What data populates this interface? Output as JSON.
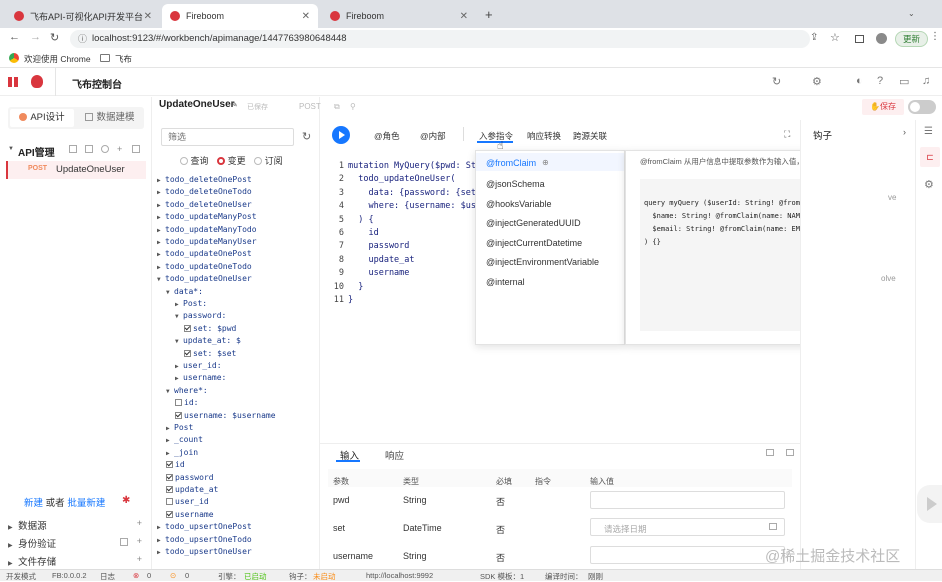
{
  "browser": {
    "tabs": [
      {
        "title": "飞布API-可视化API开发平台",
        "active": false
      },
      {
        "title": "Fireboom",
        "active": true
      },
      {
        "title": "Fireboom",
        "active": false
      }
    ],
    "new_tab": "+",
    "url": "localhost:9123/#/workbench/apimanage/1447763980648448",
    "update_label": "更新",
    "bookmarks": [
      "欢迎使用 Chrome",
      "飞布"
    ]
  },
  "app": {
    "title": "飞布控制台",
    "left_tabs": [
      "API设计",
      "数据建模"
    ],
    "api_header": "API管理",
    "api_item": {
      "method": "POST",
      "name": "UpdateOneUser"
    },
    "new_link": "新建",
    "or_text": "或者",
    "batch_link": "批量新建",
    "sections": [
      "数据源",
      "身份验证",
      "文件存储"
    ],
    "filter_placeholder": "筛选",
    "op_types": [
      "查询",
      "变更",
      "订阅"
    ],
    "operation_title": "UpdateOneUser",
    "saved_label": "已保存",
    "method_label": "POST",
    "save_button": "保存",
    "toolbar": [
      "@角色",
      "@内部",
      "入参指令",
      "响应转换",
      "跨源关联"
    ],
    "hook_label": "钩子",
    "directive_options": [
      "@fromClaim",
      "@jsonSchema",
      "@hooksVariable",
      "@injectGeneratedUUID",
      "@injectCurrentDatetime",
      "@injectEnvironmentVariable",
      "@internal"
    ],
    "hint_text": "@fromClaim 从用户信息中提取参数作为输入值，参考用法如下",
    "hint_code": "query myQuery ($userId: String! @fromClaim(name:\n  $name: String! @fromClaim(name: NAME)\n  $email: String! @fromClaim(name: EMAIL)\n) {}",
    "right_fragments": [
      "ve",
      "olve"
    ],
    "bottom_tabs": [
      "输入",
      "响应"
    ],
    "table_headers": [
      "参数",
      "类型",
      "必填",
      "指令",
      "输入值"
    ],
    "table_rows": [
      {
        "param": "pwd",
        "type": "String",
        "required": "否",
        "placeholder": ""
      },
      {
        "param": "set",
        "type": "DateTime",
        "required": "否",
        "placeholder": "请选择日期"
      },
      {
        "param": "username",
        "type": "String",
        "required": "否",
        "placeholder": ""
      }
    ],
    "watermark": "@稀土掘金技术社区"
  },
  "tree": [
    {
      "label": "todo_deleteOnePost",
      "tri": "▶",
      "indent": 0
    },
    {
      "label": "todo_deleteOneTodo",
      "tri": "▶",
      "indent": 0
    },
    {
      "label": "todo_deleteOneUser",
      "tri": "▶",
      "indent": 0
    },
    {
      "label": "todo_updateManyPost",
      "tri": "▶",
      "indent": 0
    },
    {
      "label": "todo_updateManyTodo",
      "tri": "▶",
      "indent": 0
    },
    {
      "label": "todo_updateManyUser",
      "tri": "▶",
      "indent": 0
    },
    {
      "label": "todo_updateOnePost",
      "tri": "▶",
      "indent": 0
    },
    {
      "label": "todo_updateOneTodo",
      "tri": "▶",
      "indent": 0
    },
    {
      "label": "todo_updateOneUser",
      "tri": "▼",
      "indent": 0
    },
    {
      "label": "data*:",
      "tri": "▼",
      "indent": 1
    },
    {
      "label": "Post:",
      "tri": "▶",
      "indent": 2
    },
    {
      "label": "password:",
      "tri": "▼",
      "indent": 2
    },
    {
      "label": "set: $pwd",
      "cb": true,
      "indent": 3
    },
    {
      "label": "update_at: $",
      "tri": "▼",
      "indent": 2
    },
    {
      "label": "set: $set",
      "cb": true,
      "indent": 3
    },
    {
      "label": "user_id:",
      "tri": "▶",
      "indent": 2
    },
    {
      "label": "username:",
      "tri": "▶",
      "indent": 2
    },
    {
      "label": "where*:",
      "tri": "▼",
      "indent": 1
    },
    {
      "label": "id:",
      "cb": false,
      "indent": 2
    },
    {
      "label": "username: $username",
      "cb": true,
      "indent": 2
    },
    {
      "label": "Post",
      "tri": "▶",
      "indent": 1
    },
    {
      "label": "_count",
      "tri": "▶",
      "indent": 1
    },
    {
      "label": "_join",
      "tri": "▶",
      "indent": 1
    },
    {
      "label": "id",
      "cb": true,
      "indent": 1
    },
    {
      "label": "password",
      "cb": true,
      "indent": 1
    },
    {
      "label": "update_at",
      "cb": true,
      "indent": 1
    },
    {
      "label": "user_id",
      "cb": false,
      "indent": 1
    },
    {
      "label": "username",
      "cb": true,
      "indent": 1
    },
    {
      "label": "todo_upsertOnePost",
      "tri": "▶",
      "indent": 0
    },
    {
      "label": "todo_upsertOneTodo",
      "tri": "▶",
      "indent": 0
    },
    {
      "label": "todo_upsertOneUser",
      "tri": "▶",
      "indent": 0
    }
  ],
  "code": [
    "mutation MyQuery($pwd: St",
    "  todo_updateOneUser(",
    "    data: {password: {set",
    "    where: {username: $us",
    "  ) {",
    "    id",
    "    password",
    "    update_at",
    "    username",
    "  }",
    "}"
  ],
  "status": {
    "mode": "开发模式",
    "version": "FB:0.0.0.2",
    "log": "日志",
    "errors": "0",
    "warnings": "0",
    "engine": "引擎：",
    "engine_state": "已启动",
    "hooks": "钩子：",
    "hooks_state": "未启动",
    "url": "http://localhost:9992",
    "sdk": "SDK 模板：1",
    "compile": "编译时间：",
    "compile_value": "刚刚"
  },
  "colors": {
    "accent": "#1677ff",
    "brand": "#d9363e",
    "post": "#f08a5d",
    "ok": "#52c41a",
    "warn": "#fa8c16"
  }
}
